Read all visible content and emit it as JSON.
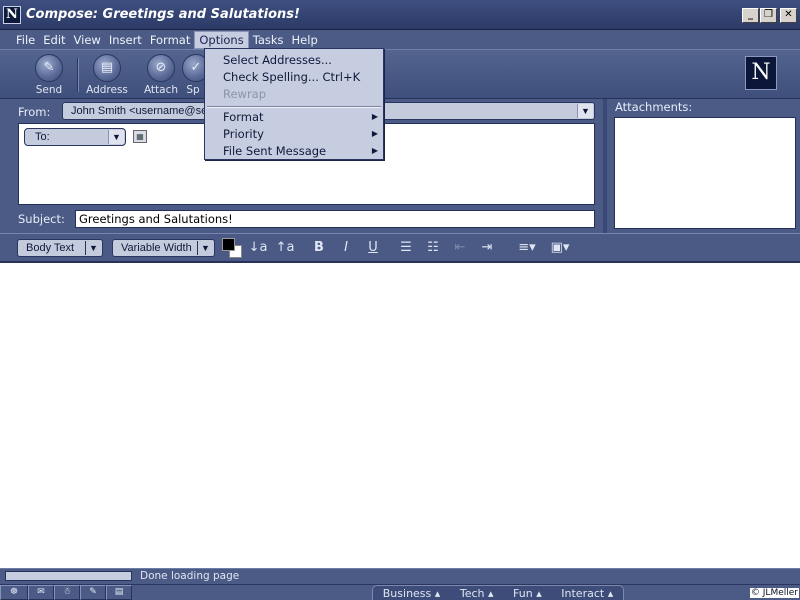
{
  "window": {
    "title": "Compose: Greetings and Salutations!",
    "app_icon": "N"
  },
  "menubar": {
    "items": [
      "File",
      "Edit",
      "View",
      "Insert",
      "Format",
      "Options",
      "Tasks",
      "Help"
    ],
    "active": "Options"
  },
  "toolbar": {
    "send_label": "Send",
    "address_label": "Address",
    "attach_label": "Attach",
    "spell_label": "Sp",
    "logo": "N"
  },
  "compose": {
    "from_label": "From:",
    "from_value": "John Smith <username@ser",
    "to_label": "To:",
    "subject_label": "Subject:",
    "subject_value": "Greetings and Salutations!",
    "attachments_label": "Attachments:"
  },
  "format_bar": {
    "style_value": "Body Text",
    "font_value": "Variable Width",
    "fg_color": "#000000",
    "bg_color": "#ffffff",
    "decrease_font": "↓a",
    "increase_font": "↑a",
    "bold": "B",
    "italic": "I",
    "underline": "U"
  },
  "options_menu": {
    "items": [
      {
        "label": "Select Addresses...",
        "enabled": true
      },
      {
        "label": "Check Spelling...  Ctrl+K",
        "enabled": true
      },
      {
        "label": "Rewrap",
        "enabled": false
      },
      {
        "label": "Format",
        "enabled": true,
        "submenu": true
      },
      {
        "label": "Priority",
        "enabled": true,
        "submenu": true
      },
      {
        "label": "File Sent Message",
        "enabled": true,
        "submenu": true
      }
    ]
  },
  "status": {
    "text": "Done loading page"
  },
  "taskbar": {
    "links": [
      "Business",
      "Tech",
      "Fun",
      "Interact"
    ],
    "copyright": "© JLMeller"
  },
  "colors": {
    "chrome": "#4b5b86",
    "titlebar": "#2b3a66",
    "menu_bg": "#c7cde0"
  }
}
